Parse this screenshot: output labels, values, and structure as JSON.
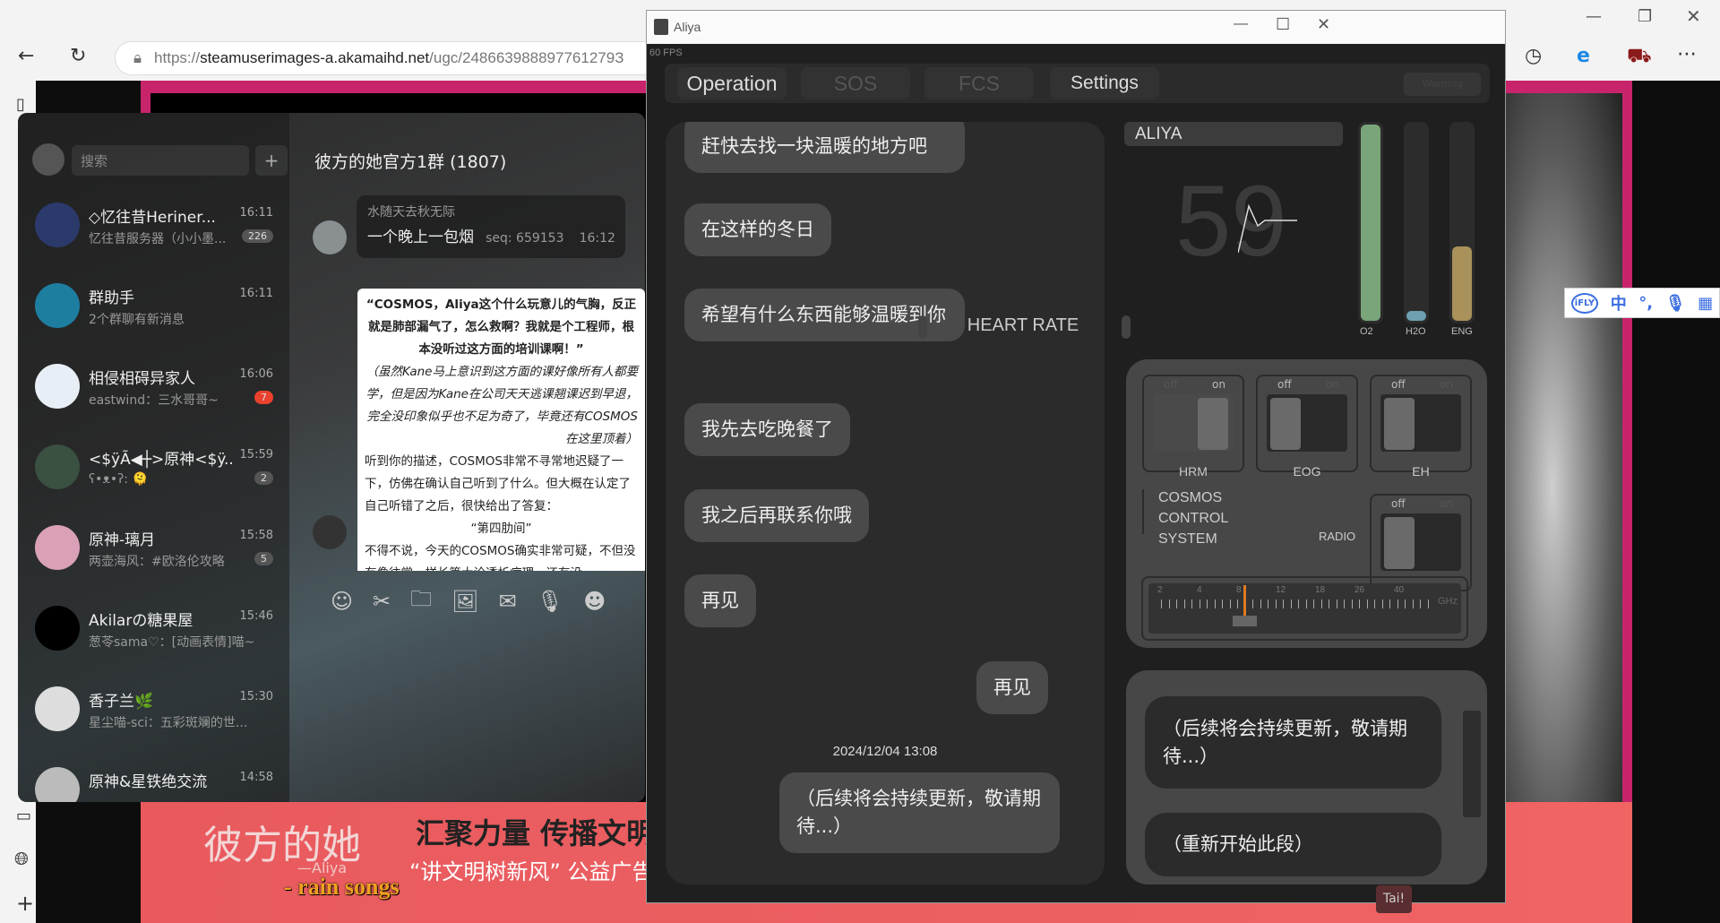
{
  "browser": {
    "url_prefix": "https://",
    "url_host": "steamuserimages-a.akamaihd.net",
    "url_path": "/ugc/248663988897761279З",
    "icons": [
      "back-icon",
      "refresh-icon",
      "lock-icon",
      "history-icon",
      "ie-mode-icon",
      "extension-icon",
      "more-icon"
    ]
  },
  "qq": {
    "search_placeholder": "搜索",
    "add": "+",
    "conversations": [
      {
        "name": "◇忆往昔Heriner...",
        "preview": "忆往昔服务器（小小墨...",
        "time": "16:11",
        "badge": "226",
        "badge_color": "#555555"
      },
      {
        "name": "群助手",
        "preview": "2个群聊有新消息",
        "time": "16:11",
        "badge": ""
      },
      {
        "name": "相侵相碍异家人",
        "preview": "eastwind：三水哥哥~",
        "time": "16:06",
        "badge": "7",
        "badge_color": "#e9412e"
      },
      {
        "name": "<$ÿÃ◀┼>原神<$ÿ...",
        "preview": "ʕ•ᴥ•ʔ: 🫠",
        "time": "15:59",
        "badge": "2",
        "badge_color": "#555555"
      },
      {
        "name": "原神-璃月",
        "preview": "两壶海风：#欧洛伦攻略",
        "time": "15:58",
        "badge": "5",
        "badge_color": "#555555"
      },
      {
        "name": "Akilarの糖果屋",
        "preview": "葱苓sama♡：[动画表情]喵~",
        "time": "15:46",
        "badge": ""
      },
      {
        "name": "香子兰🌿",
        "preview": "星尘喵-sci：五彩斑斓的世...",
        "time": "15:30",
        "badge": ""
      },
      {
        "name": "原神&星铁绝交流",
        "preview": "...",
        "time": "14:58",
        "badge": ""
      }
    ],
    "chat_title": "彼方的她官方1群 (1807)",
    "message": {
      "sender": "水随天去秋无际",
      "text": "一个晚上一包烟",
      "seq": "seq: 659153",
      "time": "16:12"
    },
    "doc_lines": [
      "“COSMOS，Aliya这个什么玩意儿的气胸，反正就是肺部漏气了，怎么救啊？我就是个工程师，根本没听过这方面的培训课啊！”",
      "（虽然Kane马上意识到这方面的课好像所有人都要学，但是因为Kane在公司天天逃课翘课迟到早退，完全没印象似乎也不足为奇了，毕竟还有COSMOS在这里顶着）",
      "听到你的描述，COSMOS非常不寻常地迟疑了一下，仿佛在确认自己听到了什么。但大概在认定了自己听错了之后，很快给出了答复：",
      "“第四肋间”",
      "不得不说，今天的COSMOS确实非常可疑，不但没有像往常一样长篇大论透析病理，还有没"
    ],
    "toolbar_icons": [
      "emoji-icon",
      "scissors-icon",
      "folder-icon",
      "image-icon",
      "envelope-icon",
      "mic-icon",
      "smile-icon"
    ]
  },
  "aliya": {
    "title": "Aliya",
    "fps": "60 FPS",
    "tabs": [
      {
        "label": "Operation",
        "active": true
      },
      {
        "label": "SOS",
        "active": false
      },
      {
        "label": "FCS",
        "active": false
      },
      {
        "label": "Settings",
        "active": true
      }
    ],
    "tab_extra": "Warning",
    "chat": [
      {
        "side": "left",
        "text": "赶快去找一块温暖的地方吧"
      },
      {
        "side": "left",
        "text": "在这样的冬日"
      },
      {
        "side": "left",
        "text": "希望有什么东西能够温暖到你"
      },
      {
        "side": "left",
        "text": "我先去吃晚餐了"
      },
      {
        "side": "left",
        "text": "我之后再联系你哦"
      },
      {
        "side": "left",
        "text": "再见"
      },
      {
        "side": "right",
        "text": "再见"
      },
      {
        "side": "right",
        "text": "（后续将会持续更新，敬请期待...）"
      }
    ],
    "timestamp": "2024/12/04  13:08",
    "patient": "ALIYA",
    "heart_rate": "59",
    "heart_rate_label": "HEART RATE",
    "gauges": [
      {
        "label": "O2",
        "level": 1.0,
        "color": "#7aa57a"
      },
      {
        "label": "H2O",
        "level": 0.05,
        "color": "#6fa0b0"
      },
      {
        "label": "ENG",
        "level": 0.38,
        "color": "#a8915a"
      }
    ],
    "toggles": [
      {
        "name": "HRM",
        "state": "on"
      },
      {
        "name": "EOG",
        "state": "off"
      },
      {
        "name": "EH",
        "state": "off"
      }
    ],
    "off": "off",
    "on": "on",
    "system_lines": [
      "COSMOS",
      "CONTROL",
      "SYSTEM"
    ],
    "radio_label": "RADIO",
    "radio_state": "off",
    "freq_ticks": [
      "2",
      "4",
      "8",
      "12",
      "18",
      "26",
      "40"
    ],
    "freq_unit": "GHz",
    "freq_value": "8",
    "accent": "#e07a1f",
    "options": [
      "（后续将会持续更新，敬请期待...）",
      "（重新开始此段）"
    ],
    "tooltip": "Tai!"
  },
  "page": {
    "banner_title": "彼方的她",
    "banner_sub": "—Aliya",
    "lyric": "- rain songs",
    "slogan1": "汇聚力量 传播文明",
    "slogan2": "“讲文明树新风” 公益广告"
  },
  "ime": {
    "items": [
      "iFLY",
      "中",
      "°,",
      "mic",
      "apps"
    ]
  }
}
